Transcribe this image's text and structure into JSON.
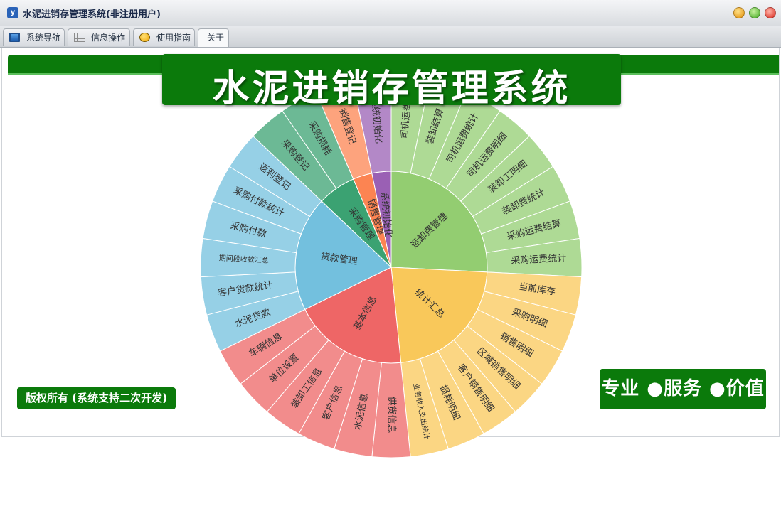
{
  "window": {
    "title": "水泥进销存管理系统(非注册用户)"
  },
  "tabs": [
    {
      "label": "系统导航",
      "icon": "monitor-icon"
    },
    {
      "label": "信息操作",
      "icon": "grid-icon"
    },
    {
      "label": "使用指南",
      "icon": "help-icon"
    },
    {
      "label": "关于",
      "icon": ""
    }
  ],
  "active_tab": "关于",
  "banner": {
    "title": "水泥进销存管理系统"
  },
  "footer": {
    "copyright": "版权所有 (系统支持二次开发)",
    "slogan": "专业 ●服务 ●价值"
  },
  "colors": {
    "brand_green": "#0b7a0b"
  },
  "chart_data": {
    "type": "sunburst",
    "categories": [
      {
        "name": "运卸费管理",
        "color": "#93cd71",
        "children": [
          "司机运费",
          "装卸结算",
          "司机运费统计",
          "司机运费明细",
          "装卸工明细",
          "装卸费统计",
          "采购运费结算",
          "采购运费统计"
        ]
      },
      {
        "name": "统计汇总",
        "color": "#f9c85a",
        "children": [
          "当前库存",
          "采购明细",
          "销售明细",
          "区域销售明细",
          "客户销售明细",
          "损耗明细",
          "业务收入支出统计"
        ]
      },
      {
        "name": "基本信息",
        "color": "#ee6666",
        "children": [
          "供货信息",
          "水泥信息",
          "客户信息",
          "装卸工信息",
          "单位设置",
          "车辆信息"
        ]
      },
      {
        "name": "货款管理",
        "color": "#73c0de",
        "children": [
          "水泥货款",
          "客户货款统计",
          "期间段收款汇总",
          "采购付款",
          "采购付款统计",
          "返利登记"
        ]
      },
      {
        "name": "采购管理",
        "color": "#3ba272",
        "children": [
          "采购登记",
          "采购损耗"
        ]
      },
      {
        "name": "销售管理",
        "color": "#fc8452",
        "children": [
          "销售登记"
        ]
      },
      {
        "name": "系统初始化",
        "color": "#9a60b4",
        "children": [
          "系统初始化"
        ]
      }
    ]
  }
}
